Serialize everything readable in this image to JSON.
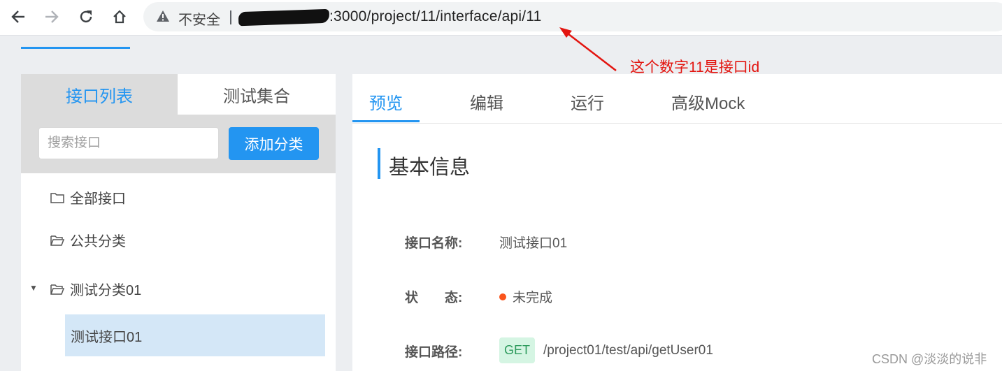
{
  "browser": {
    "security_label": "不安全",
    "url_visible": ":3000/project/11/interface/api/11"
  },
  "left": {
    "tabs": [
      {
        "label": "接口列表",
        "active": true
      },
      {
        "label": "测试集合",
        "active": false
      }
    ],
    "search_placeholder": "搜索接口",
    "add_button_label": "添加分类",
    "tree": {
      "all": "全部接口",
      "public": "公共分类",
      "group": "测试分类01",
      "leaf": "测试接口01"
    }
  },
  "right": {
    "tabs": [
      {
        "label": "预览",
        "active": true
      },
      {
        "label": "编辑",
        "active": false
      },
      {
        "label": "运行",
        "active": false
      },
      {
        "label": "高级Mock",
        "active": false
      }
    ],
    "section_title": "基本信息",
    "fields": {
      "name_label": "接口名称:",
      "name_value": "测试接口01",
      "status_label": "状　　态:",
      "status_value": "未完成",
      "path_label": "接口路径:",
      "method": "GET",
      "path_value": "/project01/test/api/getUser01"
    }
  },
  "annotation": "这个数字11是接口id",
  "watermark": "CSDN @淡淡的说非",
  "colors": {
    "accent": "#2395f1",
    "annotation": "#e3140f",
    "status_dot": "#fa541c",
    "get_badge_bg": "#d5f5e3",
    "get_badge_text": "#2e9b5d"
  }
}
